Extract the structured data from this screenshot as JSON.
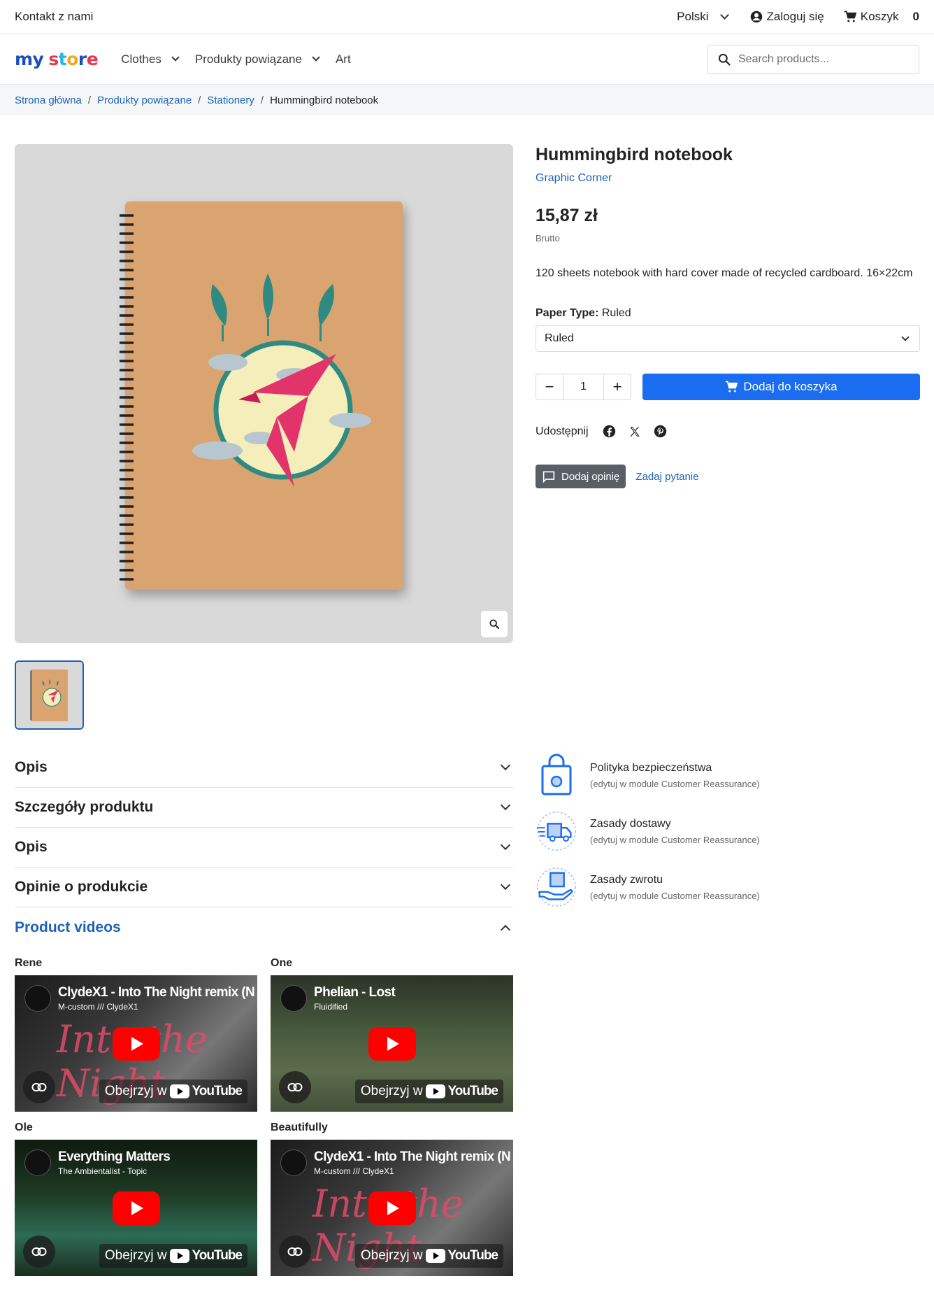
{
  "topbar": {
    "contact": "Kontakt z nami",
    "language": "Polski",
    "login": "Zaloguj się",
    "cart_label": "Koszyk",
    "cart_count": "0"
  },
  "nav": {
    "logo_my": "my",
    "logo_store": "store",
    "menu": [
      "Clothes",
      "Produkty powiązane",
      "Art"
    ],
    "search_placeholder": "Search products..."
  },
  "breadcrumb": [
    "Strona główna",
    "Produkty powiązane",
    "Stationery",
    "Hummingbird notebook"
  ],
  "product": {
    "name": "Hummingbird notebook",
    "brand": "Graphic Corner",
    "price": "15,87 zł",
    "tax_label": "Brutto",
    "description": "120 sheets notebook with hard cover made of recycled cardboard. 16×22cm",
    "option_label": "Paper Type:",
    "option_value": "Ruled",
    "select_value": "Ruled",
    "quantity": "1",
    "add_to_cart": "Dodaj do koszyka",
    "share_label": "Udostępnij",
    "add_review": "Dodaj opinię",
    "ask_question": "Zadaj pytanie"
  },
  "accordion": [
    "Opis",
    "Szczegóły produktu",
    "Opis",
    "Opinie o produkcie",
    "Product videos"
  ],
  "videos": [
    {
      "label": "Rene",
      "title": "ClydeX1 - Into The Night remix (N",
      "subtitle": "M-custom /// ClydeX1",
      "deco": "Into the Night"
    },
    {
      "label": "One",
      "title": "Phelian - Lost",
      "subtitle": "Fluidified",
      "deco": ""
    },
    {
      "label": "Ole",
      "title": "Everything Matters",
      "subtitle": "The Ambientalist - Topic",
      "deco": ""
    },
    {
      "label": "Beautifully",
      "title": "ClydeX1 - Into The Night remix (N",
      "subtitle": "M-custom /// ClydeX1",
      "deco": "Into the Night"
    }
  ],
  "video_watch": "Obejrzyj w",
  "video_brand": "YouTube",
  "reassurance": [
    {
      "title": "Polityka bezpieczeństwa",
      "sub": "(edytuj w module Customer Reassurance)"
    },
    {
      "title": "Zasady dostawy",
      "sub": "(edytuj w module Customer Reassurance)"
    },
    {
      "title": "Zasady zwrotu",
      "sub": "(edytuj w module Customer Reassurance)"
    }
  ],
  "colors": {
    "accent": "#1d62b8",
    "button": "#1a6cf0",
    "review_button": "#5a5f66"
  }
}
